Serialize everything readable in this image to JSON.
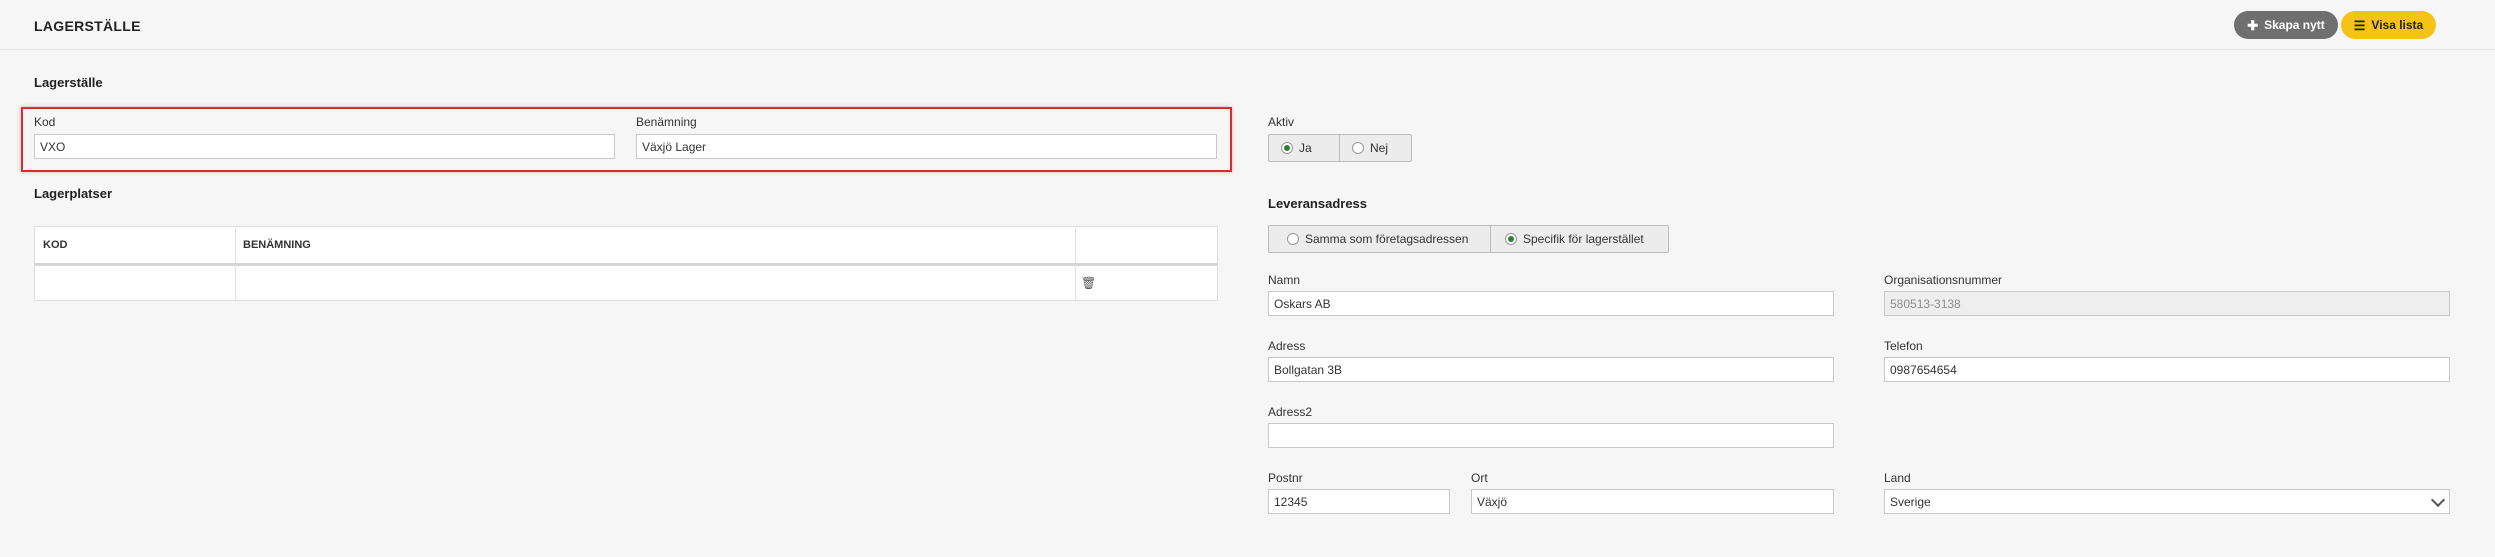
{
  "header": {
    "title": "LAGERSTÄLLE",
    "create_label": "Skapa nytt",
    "list_label": "Visa lista"
  },
  "left": {
    "section_title": "Lagerställe",
    "kod_label": "Kod",
    "kod_value": "VXO",
    "benamning_label": "Benämning",
    "benamning_value": "Växjö Lager",
    "lagerplatser_title": "Lagerplatser",
    "table": {
      "columns": [
        "KOD",
        "BENÄMNING",
        ""
      ],
      "rows": [
        [
          "",
          "",
          ""
        ]
      ]
    }
  },
  "right": {
    "aktiv_label": "Aktiv",
    "aktiv_options": [
      "Ja",
      "Nej"
    ],
    "aktiv_selected": "Ja",
    "leverans_title": "Leveransadress",
    "leverans_options": [
      "Samma som företagsadressen",
      "Specifik för lagerstället"
    ],
    "leverans_selected": "Specifik för lagerstället",
    "namn_label": "Namn",
    "namn_value": "Oskars AB",
    "org_label": "Organisationsnummer",
    "org_value": "580513-3138",
    "adress_label": "Adress",
    "adress_value": "Bollgatan 3B",
    "telefon_label": "Telefon",
    "telefon_value": "0987654654",
    "adress2_label": "Adress2",
    "adress2_value": "",
    "postnr_label": "Postnr",
    "postnr_value": "12345",
    "ort_label": "Ort",
    "ort_value": "Växjö",
    "land_label": "Land",
    "land_value": "Sverige"
  },
  "icons": {
    "create": "plus-icon",
    "list": "list-icon",
    "delete": "trash-icon",
    "select": "chevron-down-icon"
  },
  "colors": {
    "create_button": "#6f6f6f",
    "list_button": "#f5c218",
    "highlight_border": "#d32f2f",
    "radio_selected": "#2e7d32"
  }
}
